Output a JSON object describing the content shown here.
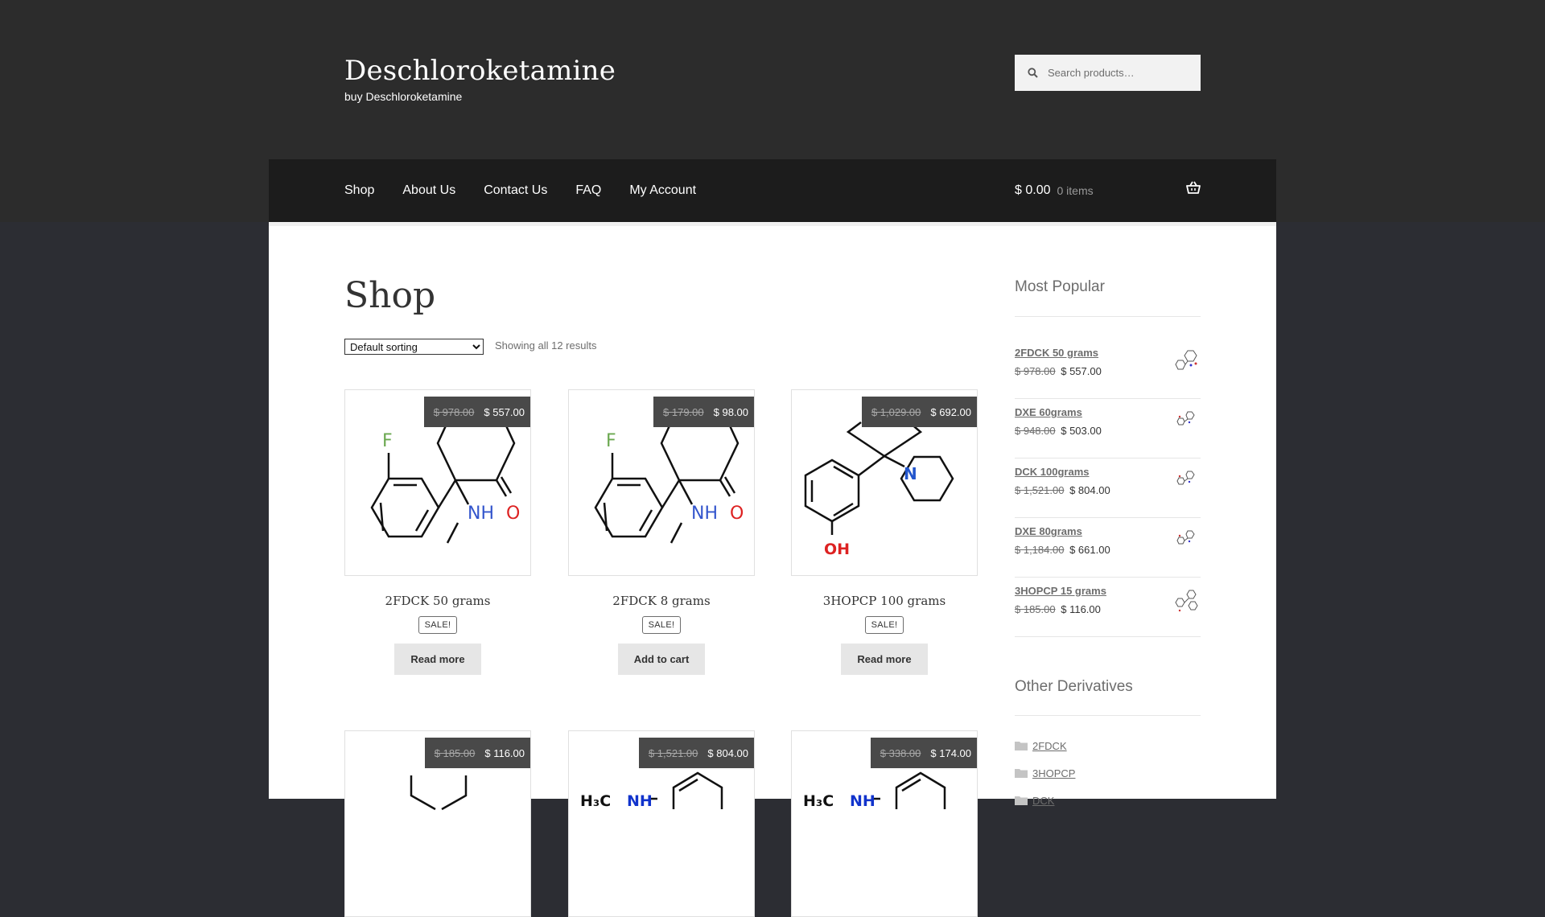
{
  "site": {
    "title": "Deschloroketamine",
    "description": "buy Deschloroketamine",
    "search_placeholder": "Search products…"
  },
  "nav": {
    "items": [
      {
        "label": "Shop"
      },
      {
        "label": "About Us"
      },
      {
        "label": "Contact Us"
      },
      {
        "label": "FAQ"
      },
      {
        "label": "My Account"
      }
    ],
    "cart_amount": "$ 0.00",
    "cart_count": "0 items"
  },
  "shop": {
    "title": "Shop",
    "sort_selected": "Default sorting",
    "result_count": "Showing all 12 results"
  },
  "products": [
    {
      "name": "2FDCK 50 grams",
      "old_price": "$ 978.00",
      "price": "$ 557.00",
      "badge": "SALE!",
      "button": "Read more"
    },
    {
      "name": "2FDCK 8 grams",
      "old_price": "$ 179.00",
      "price": "$ 98.00",
      "badge": "SALE!",
      "button": "Add to cart"
    },
    {
      "name": "3HOPCP 100 grams",
      "old_price": "$ 1,029.00",
      "price": "$ 692.00",
      "badge": "SALE!",
      "button": "Read more"
    },
    {
      "old_price": "$ 185.00",
      "price": "$ 116.00"
    },
    {
      "old_price": "$ 1,521.00",
      "price": "$ 804.00"
    },
    {
      "old_price": "$ 338.00",
      "price": "$ 174.00"
    }
  ],
  "molecule_labels": {
    "f": "F",
    "nh": "NH",
    "o": "O",
    "n": "N",
    "oh": "OH",
    "h3c": "H₃C",
    "nh2": "NH"
  },
  "sidebar": {
    "popular_title": "Most Popular",
    "popular": [
      {
        "title": "2FDCK 50 grams",
        "old_price": "$ 978.00",
        "price": "$ 557.00"
      },
      {
        "title": "DXE 60grams",
        "old_price": "$ 948.00",
        "price": "$ 503.00"
      },
      {
        "title": "DCK 100grams",
        "old_price": "$ 1,521.00",
        "price": "$ 804.00"
      },
      {
        "title": "DXE 80grams",
        "old_price": "$ 1,184.00",
        "price": "$ 661.00"
      },
      {
        "title": "3HOPCP 15 grams",
        "old_price": "$ 185.00",
        "price": "$ 116.00"
      }
    ],
    "derivatives_title": "Other Derivatives",
    "derivatives": [
      {
        "label": "2FDCK"
      },
      {
        "label": "3HOPCP"
      },
      {
        "label": "DCK"
      }
    ]
  }
}
